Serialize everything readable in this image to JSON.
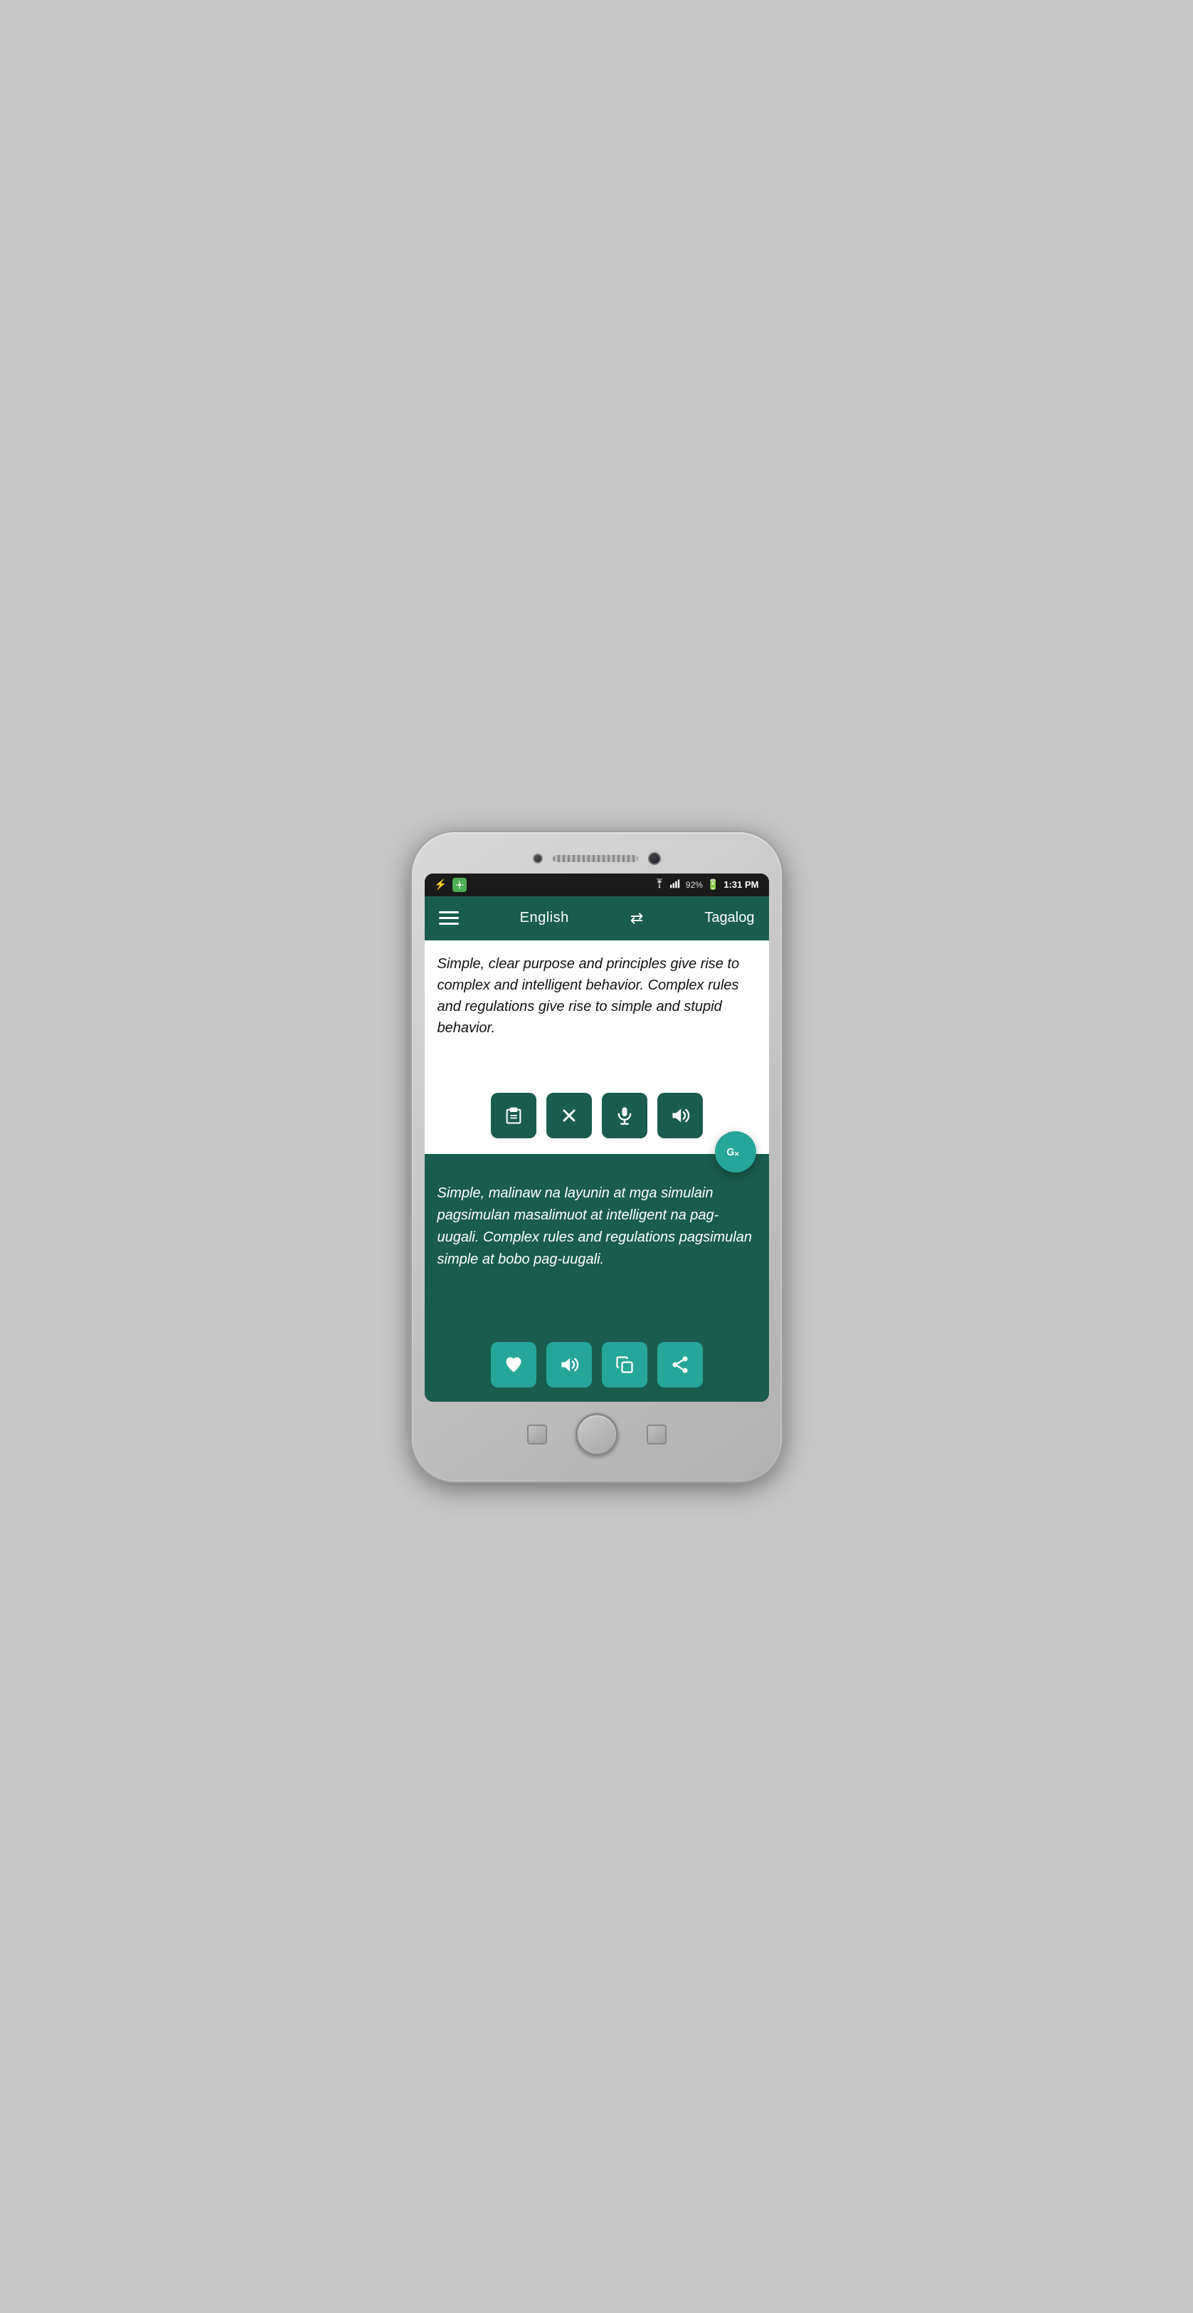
{
  "device": {
    "status_bar": {
      "time": "1:31 PM",
      "battery": "92%",
      "battery_charging": true
    }
  },
  "header": {
    "menu_label": "menu",
    "lang_from": "English",
    "swap_label": "swap languages",
    "lang_to": "Tagalog"
  },
  "input": {
    "text": "Simple, clear purpose and principles give rise to complex and intelligent behavior. Complex rules and regulations give rise to simple and stupid behavior.",
    "controls": {
      "paste_label": "paste",
      "clear_label": "clear",
      "mic_label": "microphone",
      "speak_label": "speak"
    }
  },
  "gtranslate": {
    "label": "G×"
  },
  "output": {
    "text": "Simple, malinaw na layunin at mga simulain pagsimulan masalimuot at intelligent na pag-uugali. Complex rules and regulations pagsimulan simple at bobo pag-uugali.",
    "controls": {
      "favorite_label": "favorite",
      "speak_label": "speak",
      "copy_label": "copy",
      "share_label": "share"
    }
  }
}
